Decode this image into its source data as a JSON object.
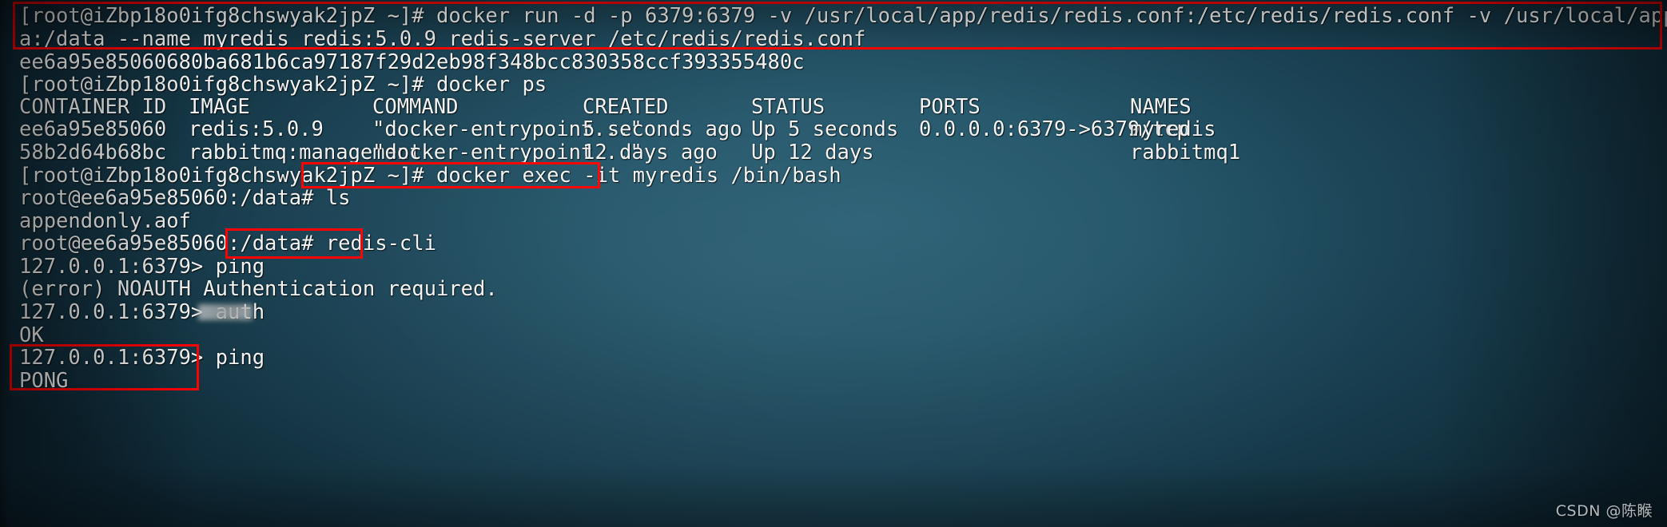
{
  "terminal": {
    "prompt_host": "[root@iZbp18o0ifg8chswyak2jpZ ~]#",
    "container_prompt": "root@ee6a95e85060:/data#",
    "redis_prompt": "127.0.0.1:6379>",
    "lines": {
      "run_cmd_part1": "[root@iZbp18o0ifg8chswyak2jpZ ~]# docker run -d -p 6379:6379 -v /usr/local/app/redis/redis.conf:/etc/redis/redis.conf -v /usr/local/app/redis/dat",
      "run_cmd_part2": "a:/data --name myredis redis:5.0.9 redis-server /etc/redis/redis.conf",
      "container_hash": "ee6a95e85060680ba681b6ca97187f29d2eb98f348bcc830358ccf393355480c",
      "ps_cmd": "[root@iZbp18o0ifg8chswyak2jpZ ~]# docker ps",
      "exec_prompt": "[root@iZbp18o0ifg8chswyak2jpZ ~]# ",
      "exec_cmd": "docker exec -it myredis /bin/bash",
      "ls_cmd": "root@ee6a95e85060:/data# ls",
      "ls_output": "appendonly.aof",
      "rediscli_prompt": "root@ee6a95e85060:/data# ",
      "rediscli_cmd": "redis-cli",
      "ping1": "127.0.0.1:6379> ping",
      "noauth_error": "(error) NOAUTH Authentication required.",
      "auth_cmd": "127.0.0.1:6379> auth ",
      "auth_password_redacted": "",
      "ok": "OK",
      "ping2": "127.0.0.1:6379> ping",
      "pong": "PONG"
    }
  },
  "docker_ps": {
    "headers": [
      "CONTAINER ID",
      "IMAGE",
      "COMMAND",
      "CREATED",
      "STATUS",
      "PORTS",
      "NAMES"
    ],
    "rows": [
      {
        "container_id": "ee6a95e85060",
        "image": "redis:5.0.9",
        "command": "\"docker-entrypoint...\"",
        "created": "5 seconds ago",
        "status": "Up 5 seconds",
        "ports": "0.0.0.0:6379->6379/tcp",
        "names": "myredis"
      },
      {
        "container_id": "58b2d64b68bc",
        "image": "rabbitmq:management",
        "command": "\"docker-entrypoint...\"",
        "created": "12 days ago",
        "status": "Up 12 days",
        "ports": "",
        "names": "rabbitmq1"
      }
    ]
  },
  "annotations": {
    "highlight_color": "#ff0000",
    "boxes": [
      {
        "name": "docker-run-command-highlight"
      },
      {
        "name": "docker-exec-command-highlight"
      },
      {
        "name": "redis-cli-command-highlight"
      },
      {
        "name": "ping-pong-result-highlight"
      }
    ]
  },
  "watermark": {
    "text": "CSDN @陈睺"
  }
}
